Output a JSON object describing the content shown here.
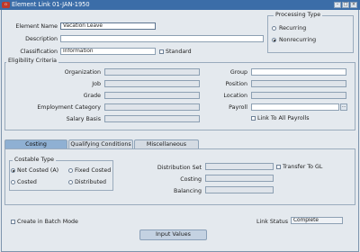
{
  "window": {
    "title": "Element Link 01-JAN-1950",
    "badge": "O",
    "controls": {
      "minimize": "–",
      "maximize": "□",
      "close": "×"
    }
  },
  "element": {
    "name_label": "Element Name",
    "name_value": "Vacation Leave",
    "description_label": "Description",
    "description_value": "",
    "classification_label": "Classification",
    "classification_value": "Information",
    "standard_label": "Standard",
    "standard_checked": false
  },
  "processing_type": {
    "title": "Processing Type",
    "options": [
      {
        "label": "Recurring",
        "selected": false
      },
      {
        "label": "Nonrecurring",
        "selected": true
      }
    ]
  },
  "eligibility": {
    "title": "Eligibility Criteria",
    "left_fields": [
      {
        "label": "Organization",
        "value": ""
      },
      {
        "label": "Job",
        "value": ""
      },
      {
        "label": "Grade",
        "value": ""
      },
      {
        "label": "Employment Category",
        "value": ""
      },
      {
        "label": "Salary Basis",
        "value": ""
      }
    ],
    "right_fields": [
      {
        "label": "Group",
        "value": ""
      },
      {
        "label": "Position",
        "value": ""
      },
      {
        "label": "Location",
        "value": ""
      },
      {
        "label": "Payroll",
        "value": ""
      }
    ],
    "payroll_lov": "...",
    "link_all_payrolls_label": "Link To All Payrolls",
    "link_all_payrolls_checked": false
  },
  "tabs": [
    {
      "label": "Costing",
      "active": true
    },
    {
      "label": "Qualifying Conditions",
      "active": false
    },
    {
      "label": "Miscellaneous",
      "active": false
    }
  ],
  "costing": {
    "costable_type_title": "Costable Type",
    "options": [
      {
        "label": "Not Costed (A)",
        "selected": true
      },
      {
        "label": "Fixed Costed",
        "selected": false
      },
      {
        "label": "Costed",
        "selected": false
      },
      {
        "label": "Distributed",
        "selected": false
      }
    ],
    "distribution_set_label": "Distribution Set",
    "distribution_set_value": "",
    "transfer_to_gl_label": "Transfer To GL",
    "transfer_to_gl_checked": false,
    "costing_label": "Costing",
    "costing_value": "",
    "balancing_label": "Balancing",
    "balancing_value": ""
  },
  "footer": {
    "create_batch_label": "Create in Batch Mode",
    "create_batch_checked": false,
    "link_status_label": "Link Status",
    "link_status_value": "Complete",
    "input_values_button": "Input Values"
  }
}
